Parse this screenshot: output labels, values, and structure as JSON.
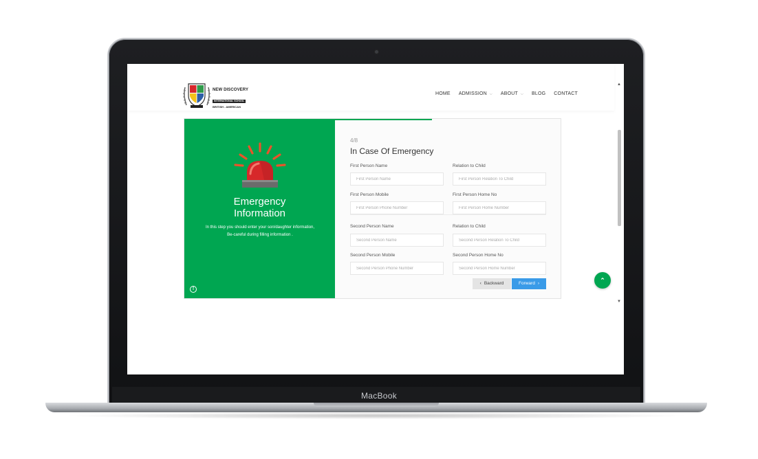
{
  "device": {
    "brand_label": "MacBook"
  },
  "header": {
    "logo": {
      "line1": "NEW DISCOVERY",
      "line2": "INTERNATIONAL SCHOOL",
      "line3": "BRITISH - AMERICAN"
    },
    "nav": [
      {
        "label": "HOME",
        "has_dropdown": false
      },
      {
        "label": "ADMISSION",
        "has_dropdown": true
      },
      {
        "label": "ABOUT",
        "has_dropdown": true
      },
      {
        "label": "BLOG",
        "has_dropdown": false
      },
      {
        "label": "CONTACT",
        "has_dropdown": false
      }
    ]
  },
  "panel": {
    "icon": "siren-icon",
    "title_line1": "Emergency",
    "title_line2": "Information",
    "description": "In this step you should enter your son/daughter information, Be-careful during filling information ."
  },
  "form": {
    "step": "4/8",
    "progress_fraction": 0.5,
    "title": "In Case Of Emergency",
    "fields": {
      "first_name": {
        "label": "First Person Name",
        "placeholder": "First Person Name"
      },
      "first_relation": {
        "label": "Relation to Child",
        "placeholder": "First Person Relation To Child"
      },
      "first_mobile": {
        "label": "First Person Mobile",
        "placeholder": "First Person Phone Number"
      },
      "first_home": {
        "label": "First Person Home No",
        "placeholder": "First Person Home Number"
      },
      "second_name": {
        "label": "Second Person Name",
        "placeholder": "Second Person Name"
      },
      "second_relation": {
        "label": "Relation to Child",
        "placeholder": "Second Person Relation To Child"
      },
      "second_mobile": {
        "label": "Second Person Mobile",
        "placeholder": "Second Person Phone Number"
      },
      "second_home": {
        "label": "Second Person Home No",
        "placeholder": "Second Person Home Number"
      }
    },
    "buttons": {
      "backward": "Backward",
      "forward": "Forward"
    }
  },
  "colors": {
    "brand_green": "#00a651",
    "button_blue": "#3a9be8",
    "button_grey": "#e4e4e4"
  }
}
